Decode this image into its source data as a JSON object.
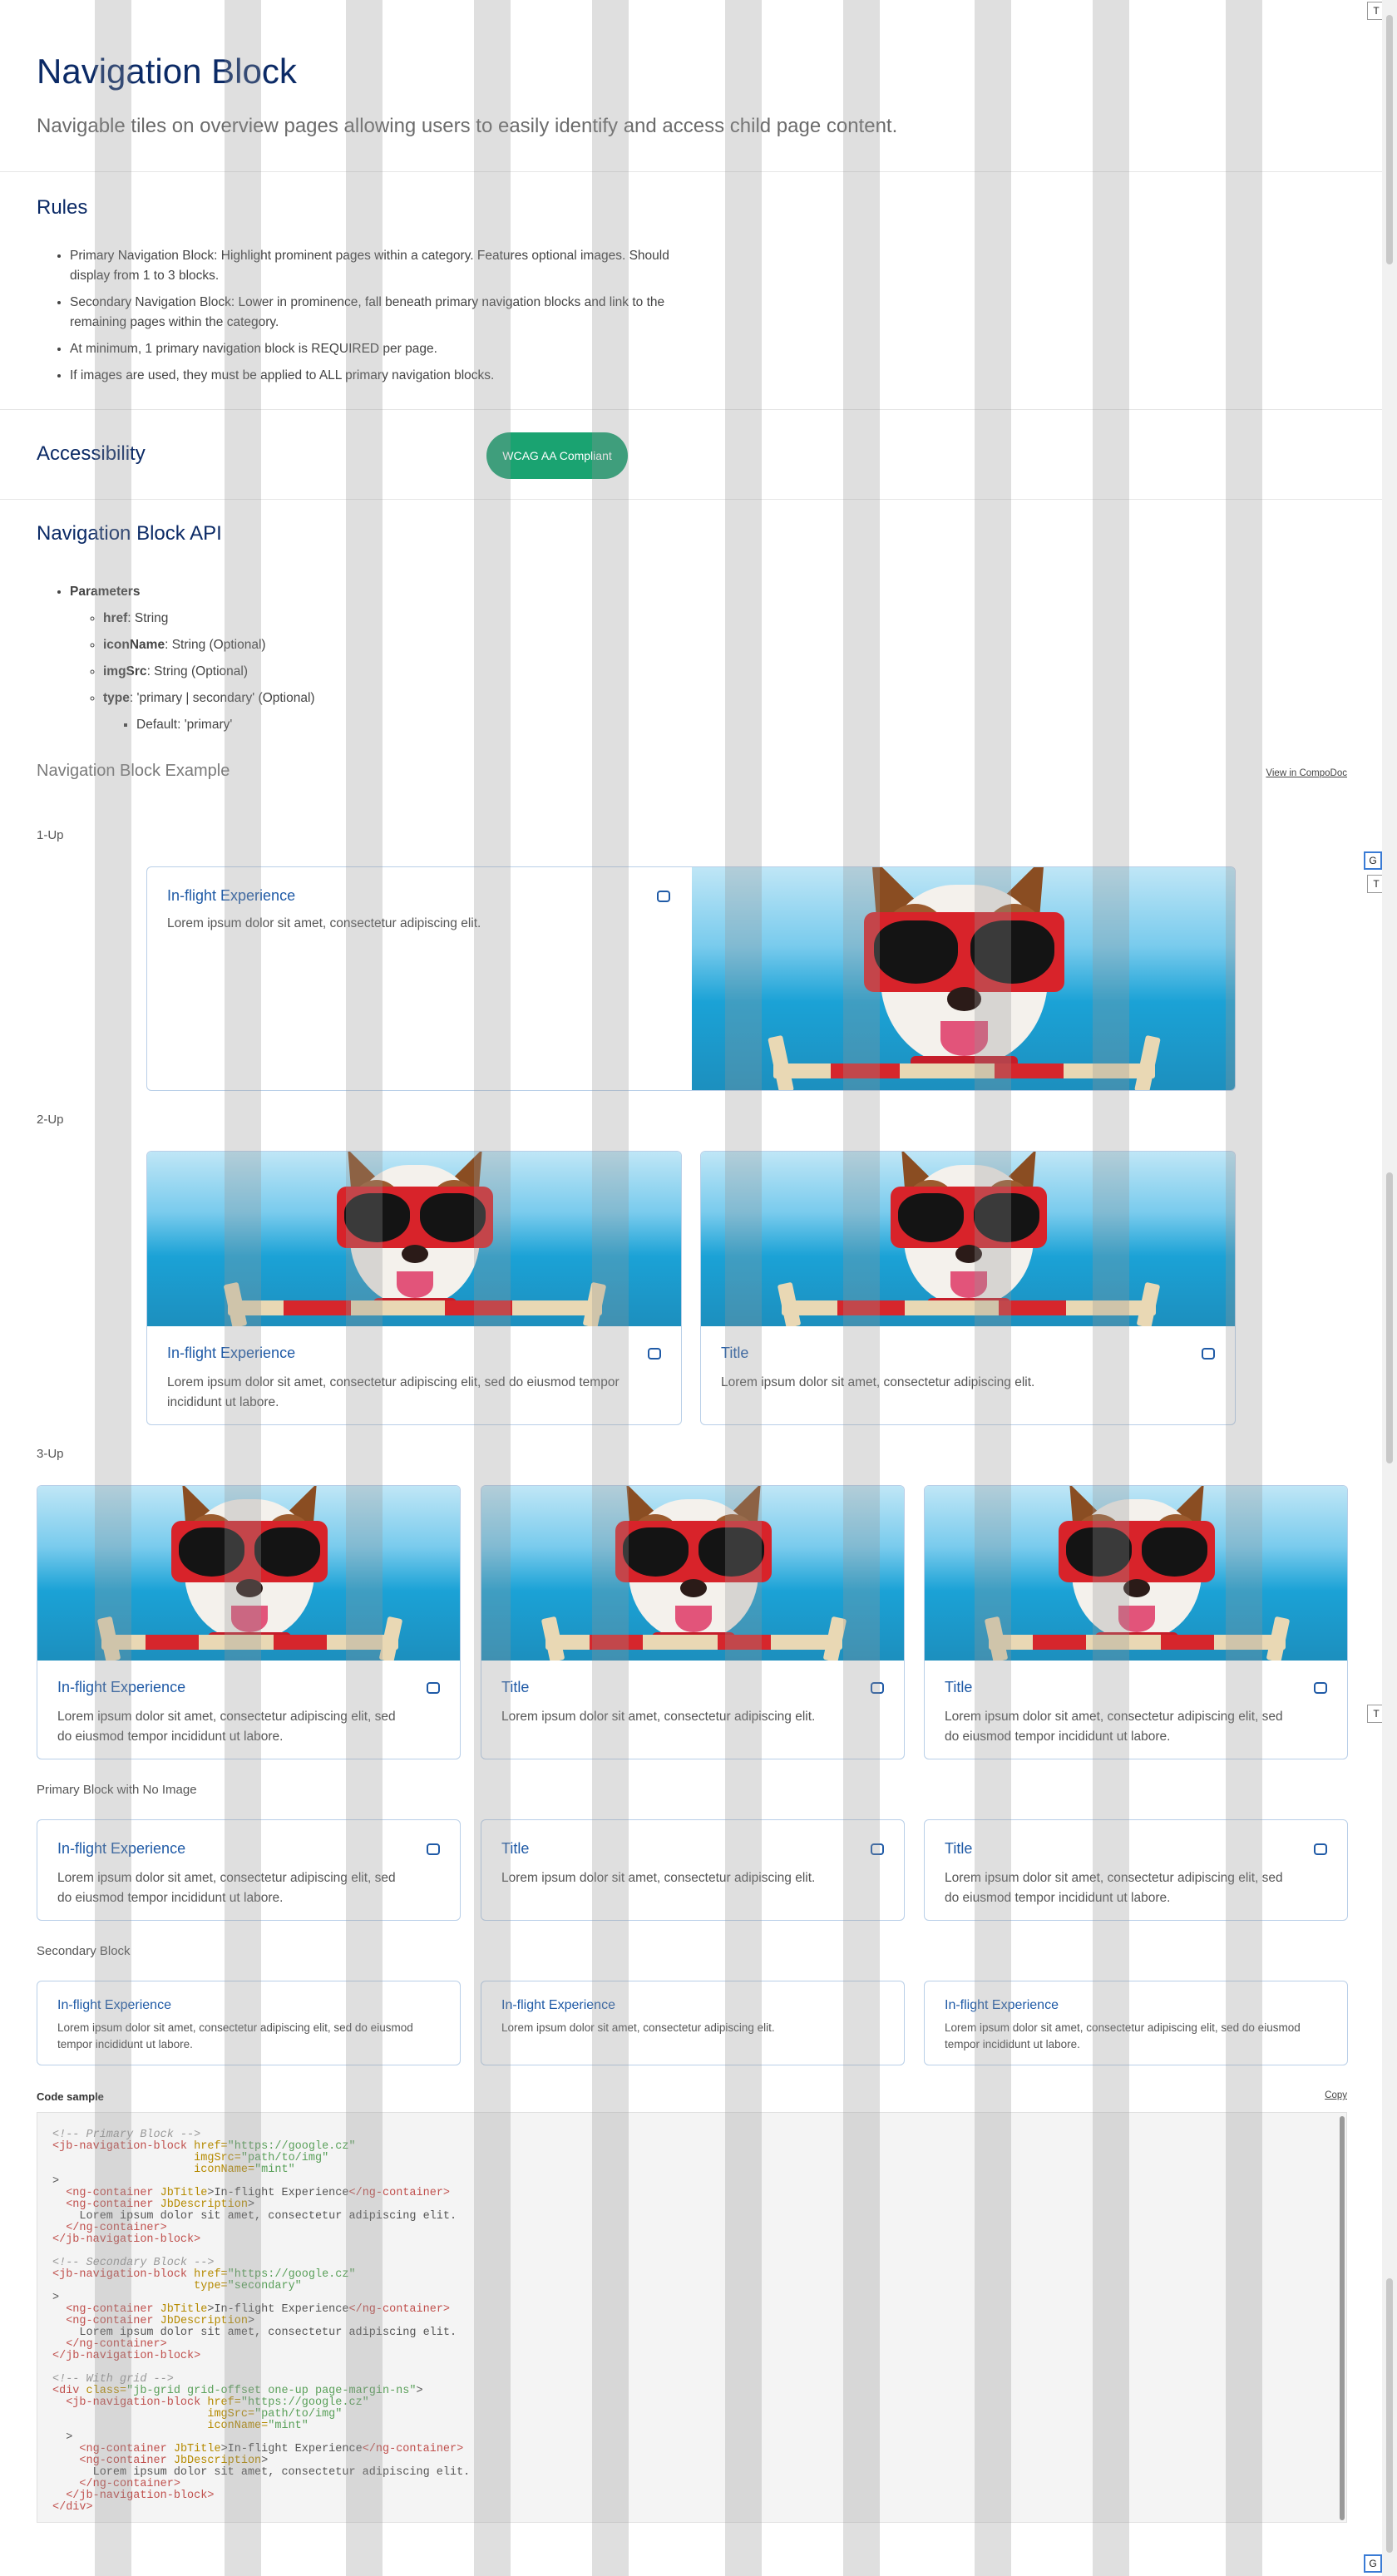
{
  "header": {
    "title": "Navigation Block",
    "subtitle": "Navigable tiles on overview pages allowing users to easily identify and access child page content."
  },
  "rules": {
    "heading": "Rules",
    "items": [
      "Primary Navigation Block: Highlight prominent pages within a category. Features optional images. Should display from 1 to 3 blocks.",
      "Secondary Navigation Block: Lower in prominence, fall beneath primary navigation blocks and link to the remaining pages within the category.",
      "At minimum, 1 primary navigation block is REQUIRED per page.",
      "If images are used, they must be applied to ALL primary navigation blocks."
    ]
  },
  "accessibility": {
    "heading": "Accessibility",
    "badge": "WCAG AA Compliant",
    "badge_color": "#1aa371"
  },
  "api": {
    "heading": "Navigation Block API",
    "parameters_label": "Parameters",
    "params": [
      {
        "name": "href",
        "desc": ": String"
      },
      {
        "name": "iconName",
        "desc": ": String (Optional)"
      },
      {
        "name": "imgSrc",
        "desc": ": String (Optional)"
      },
      {
        "name": "type",
        "desc": ": 'primary | secondary' (Optional)"
      }
    ],
    "type_default": "Default: 'primary'"
  },
  "example": {
    "heading": "Navigation Block Example",
    "compodoc_link": "View in CompoDoc",
    "labels": {
      "one_up": "1-Up",
      "two_up": "2-Up",
      "three_up": "3-Up",
      "no_image": "Primary Block with No Image",
      "secondary": "Secondary Block"
    },
    "one_up": [
      {
        "title": "In-flight Experience",
        "desc": "Lorem ipsum dolor sit amet, consectetur adipiscing elit."
      }
    ],
    "two_up": [
      {
        "title": "In-flight Experience",
        "desc": "Lorem ipsum dolor sit amet, consectetur adipiscing elit, sed do eiusmod tempor incididunt ut labore."
      },
      {
        "title": "Title",
        "desc": "Lorem ipsum dolor sit amet, consectetur adipiscing elit."
      }
    ],
    "three_up": [
      {
        "title": "In-flight Experience",
        "desc": "Lorem ipsum dolor sit amet, consectetur adipiscing elit, sed do eiusmod tempor incididunt ut labore."
      },
      {
        "title": "Title",
        "desc": "Lorem ipsum dolor sit amet, consectetur adipiscing elit."
      },
      {
        "title": "Title",
        "desc": "Lorem ipsum dolor sit amet, consectetur adipiscing elit, sed do eiusmod tempor incididunt ut labore."
      }
    ],
    "no_image": [
      {
        "title": "In-flight Experience",
        "desc": "Lorem ipsum dolor sit amet, consectetur adipiscing elit, sed do eiusmod tempor incididunt ut labore."
      },
      {
        "title": "Title",
        "desc": "Lorem ipsum dolor sit amet, consectetur adipiscing elit."
      },
      {
        "title": "Title",
        "desc": "Lorem ipsum dolor sit amet, consectetur adipiscing elit, sed do eiusmod tempor incididunt ut labore."
      }
    ],
    "secondary": [
      {
        "title": "In-flight Experience",
        "desc": "Lorem ipsum dolor sit amet, consectetur adipiscing elit, sed do eiusmod tempor incididunt ut labore."
      },
      {
        "title": "In-flight Experience",
        "desc": "Lorem ipsum dolor sit amet, consectetur adipiscing elit."
      },
      {
        "title": "In-flight Experience",
        "desc": "Lorem ipsum dolor sit amet, consectetur adipiscing elit, sed do eiusmod tempor incididunt ut labore."
      }
    ],
    "card_icon": "square-rounded-icon",
    "accent_color": "#1f5aa6"
  },
  "code": {
    "label": "Code sample",
    "copy": "Copy"
  },
  "side_buttons": {
    "t": "T",
    "g": "G"
  }
}
